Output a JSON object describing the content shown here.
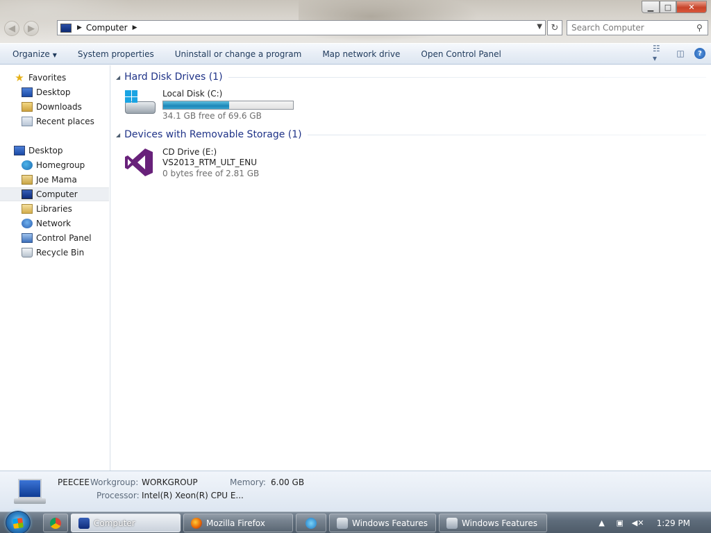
{
  "window": {
    "controls": {
      "minimize": "▁",
      "maximize": "□",
      "close": "✕"
    }
  },
  "address": {
    "crumb": "Computer",
    "search_placeholder": "Search Computer"
  },
  "toolbar": {
    "organize": "Organize",
    "system_properties": "System properties",
    "uninstall": "Uninstall or change a program",
    "map_drive": "Map network drive",
    "control_panel": "Open Control Panel"
  },
  "sidebar": {
    "favorites": "Favorites",
    "fav_items": [
      "Desktop",
      "Downloads",
      "Recent places"
    ],
    "desktop": "Desktop",
    "desktop_items": [
      "Homegroup",
      "Joe Mama",
      "Computer",
      "Libraries",
      "Network",
      "Control Panel",
      "Recycle Bin"
    ],
    "selected": "Computer"
  },
  "groups": {
    "hdd_title": "Hard Disk Drives (1)",
    "removable_title": "Devices with Removable Storage (1)"
  },
  "drives": {
    "local": {
      "name": "Local Disk (C:)",
      "free": "34.1 GB free of 69.6 GB",
      "used_fraction": 0.51
    },
    "cd": {
      "name": "CD Drive (E:)",
      "label": "VS2013_RTM_ULT_ENU",
      "free": "0 bytes free of 2.81 GB"
    }
  },
  "details": {
    "computer_name": "PEECEE",
    "workgroup_label": "Workgroup:",
    "workgroup": "WORKGROUP",
    "memory_label": "Memory:",
    "memory": "6.00 GB",
    "processor_label": "Processor:",
    "processor": "Intel(R) Xeon(R) CPU E..."
  },
  "taskbar": {
    "items": [
      "Computer",
      "Mozilla Firefox",
      "Windows Features",
      "Windows Features"
    ],
    "clock": "1:29 PM"
  },
  "colors": {
    "accent_link": "#1e3287",
    "drive_bar": "#1d87b8",
    "vs_purple": "#68217a"
  },
  "icons": {
    "star": "★",
    "search": "⚲",
    "refresh": "↻",
    "back": "◀",
    "forward": "▶",
    "help": "?"
  }
}
